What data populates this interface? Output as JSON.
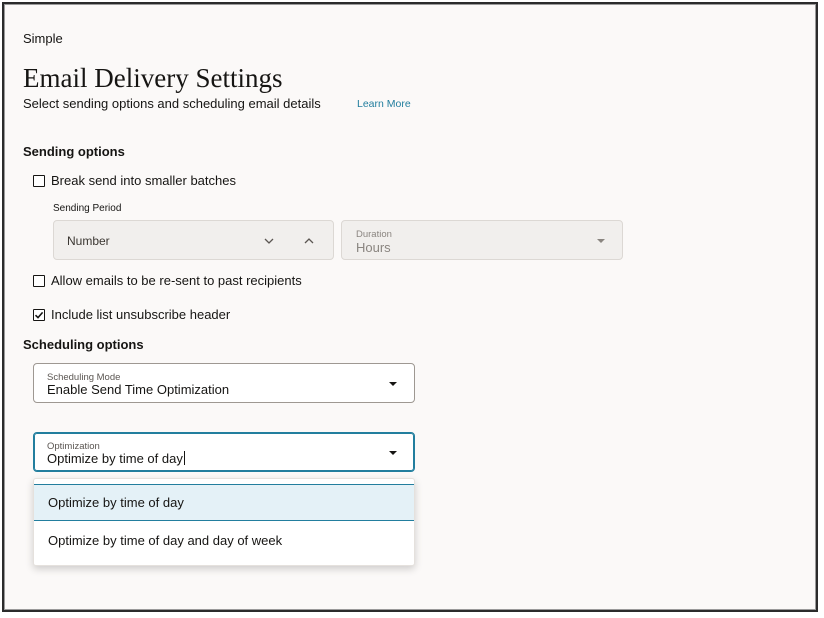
{
  "breadcrumb": "Simple",
  "page": {
    "title": "Email Delivery Settings",
    "subtitle": "Select sending options and scheduling email details",
    "learn_more": "Learn More"
  },
  "sending_options": {
    "heading": "Sending options",
    "batch_checkbox": {
      "label": "Break send into smaller batches",
      "checked": false
    },
    "sending_period": {
      "label": "Sending Period",
      "number_placeholder": "Number",
      "duration_label": "Duration",
      "duration_value": "Hours"
    },
    "resend_checkbox": {
      "label": "Allow emails to be re-sent to past recipients",
      "checked": false
    },
    "unsubscribe_checkbox": {
      "label": "Include list unsubscribe header",
      "checked": true
    }
  },
  "scheduling_options": {
    "heading": "Scheduling options",
    "scheduling_mode": {
      "label": "Scheduling Mode",
      "value": "Enable Send Time Optimization"
    },
    "optimization": {
      "label": "Optimization",
      "value": "Optimize by time of day",
      "options": [
        "Optimize by time of day",
        "Optimize by time of day and day of week"
      ],
      "highlighted_index": 0
    }
  },
  "colors": {
    "accent": "#227e9e",
    "highlight_bg": "#e4f1f7",
    "page_bg": "#fbf9f8",
    "disabled_bg": "#f1efed"
  },
  "icons": [
    "chevron-down-icon",
    "chevron-up-icon",
    "caret-down-icon",
    "check-icon"
  ]
}
